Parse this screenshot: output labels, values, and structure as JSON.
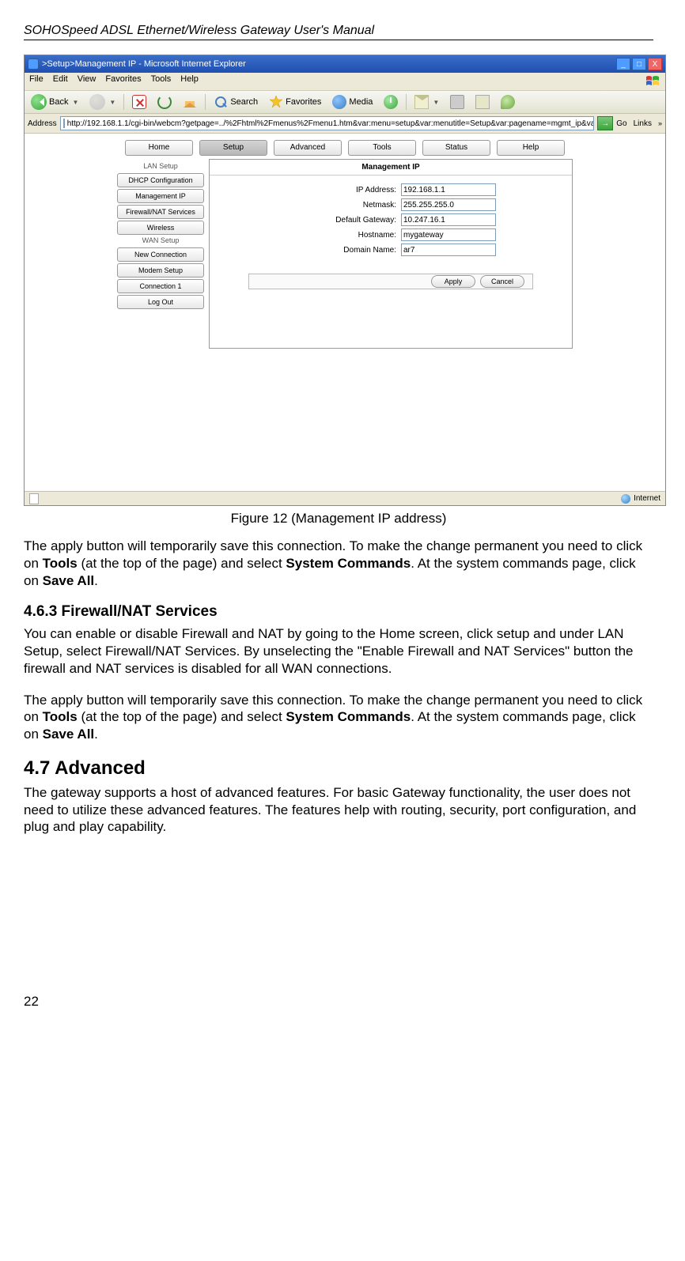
{
  "header_line": "SOHOSpeed ADSL Ethernet/Wireless Gateway User's Manual",
  "window": {
    "title": ">Setup>Management IP - Microsoft Internet Explorer",
    "menus": [
      "File",
      "Edit",
      "View",
      "Favorites",
      "Tools",
      "Help"
    ],
    "toolbar": {
      "back": "Back",
      "search": "Search",
      "favorites": "Favorites",
      "media": "Media"
    },
    "address_label": "Address",
    "url": "http://192.168.1.1/cgi-bin/webcm?getpage=../%2Fhtml%2Fmenus%2Fmenu1.htm&var:menu=setup&var:menutitle=Setup&var:pagename=mgmt_ip&var:pagetitle=Mana",
    "go": "Go",
    "links": "Links"
  },
  "router": {
    "tabs": [
      "Home",
      "Setup",
      "Advanced",
      "Tools",
      "Status",
      "Help"
    ],
    "sidebar_label": "LAN Setup",
    "sidebar": [
      "DHCP Configuration",
      "Management IP",
      "Firewall/NAT Services",
      "Wireless",
      "WAN Setup",
      "New Connection",
      "Modem Setup",
      "Connection 1",
      "Log Out"
    ],
    "panel_title": "Management IP",
    "fields": [
      {
        "label": "IP Address:",
        "value": "192.168.1.1"
      },
      {
        "label": "Netmask:",
        "value": "255.255.255.0"
      },
      {
        "label": "Default Gateway:",
        "value": "10.247.16.1"
      },
      {
        "label": "Hostname:",
        "value": "mygateway"
      },
      {
        "label": "Domain Name:",
        "value": "ar7"
      }
    ],
    "apply": "Apply",
    "cancel": "Cancel"
  },
  "status_text": "Internet",
  "fig_caption": "Figure 12 (Management IP address)",
  "p1a": "The apply button will temporarily save this connection. To make the change permanent you need to click on ",
  "p1b": "Tools",
  "p1c": " (at the top of the page) and select ",
  "p1d": "System Commands",
  "p1e": ". At the system commands page, click on ",
  "p1f": "Save All",
  "p1g": ".",
  "h463": "4.6.3  Firewall/NAT Services",
  "p2": "You can enable or disable Firewall and NAT by going to the Home screen, click setup and under LAN Setup, select Firewall/NAT Services. By unselecting the \"Enable Firewall and NAT Services\" button the firewall and NAT services is disabled for all WAN connections.",
  "h47": "4.7   Advanced",
  "p4": "The gateway supports a host of advanced features. For basic Gateway functionality, the user does not need to utilize these advanced features. The features help with routing, security, port configuration, and plug and play capability.",
  "page_num": "22"
}
